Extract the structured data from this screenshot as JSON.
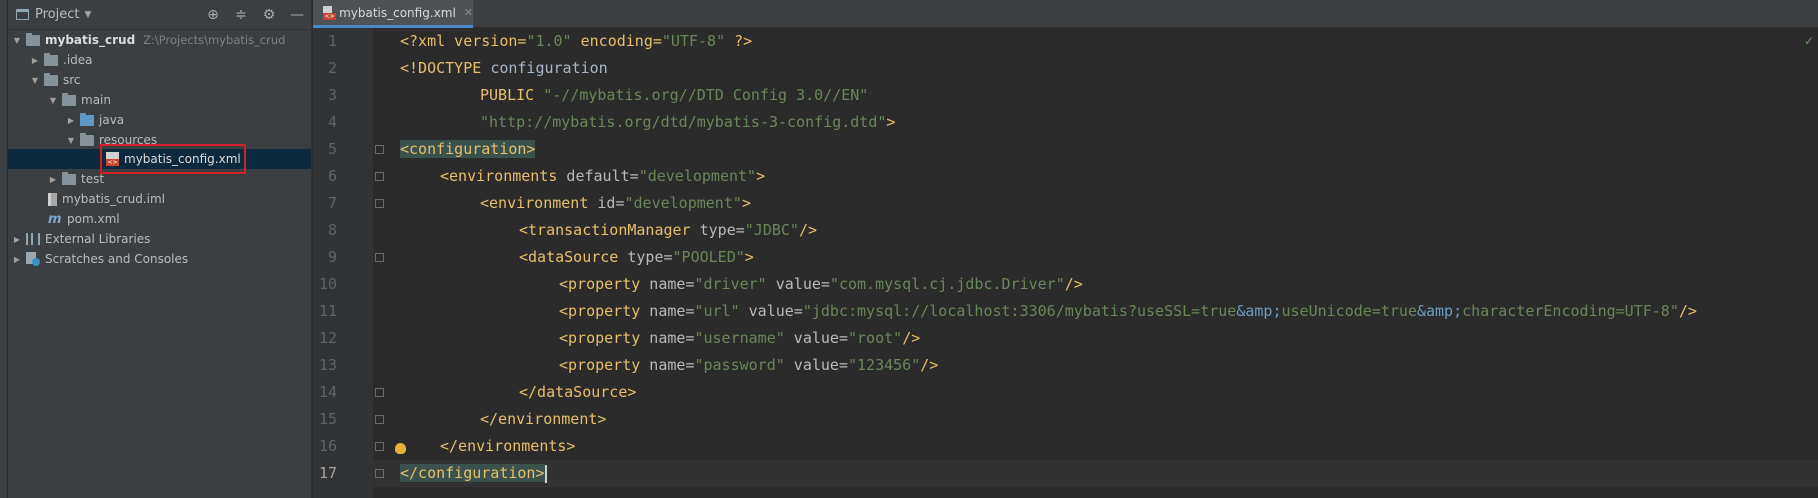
{
  "project_panel": {
    "title": "Project",
    "tree": [
      {
        "label": "mybatis_crud",
        "path": "Z:\\Projects\\mybatis_crud"
      },
      {
        "label": ".idea"
      },
      {
        "label": "src"
      },
      {
        "label": "main"
      },
      {
        "label": "java"
      },
      {
        "label": "resources"
      },
      {
        "label": "mybatis_config.xml"
      },
      {
        "label": "test"
      },
      {
        "label": "mybatis_crud.iml"
      },
      {
        "label": "pom.xml"
      },
      {
        "label": "External Libraries"
      },
      {
        "label": "Scratches and Consoles"
      }
    ]
  },
  "editor": {
    "tab_label": "mybatis_config.xml",
    "current_line": 17,
    "line_numbers": [
      "1",
      "2",
      "3",
      "4",
      "5",
      "6",
      "7",
      "8",
      "9",
      "10",
      "11",
      "12",
      "13",
      "14",
      "15",
      "16",
      "17"
    ],
    "code": {
      "l1_decl": "<?xml version=",
      "l1_v": "\"1.0\"",
      "l1_enc": " encoding=",
      "l1_ev": "\"UTF-8\"",
      "l1_end": " ?>",
      "l2_doctype": "<!DOCTYPE ",
      "l2_name": "configuration",
      "l3_kw": "PUBLIC ",
      "l3_str": "\"-//mybatis.org//DTD Config 3.0//EN\"",
      "l4_str": "\"http://mybatis.org/dtd/mybatis-3-config.dtd\"",
      "l4_end": ">",
      "l5_tag": "<configuration>",
      "l6_open": "<environments",
      "l6_attr": " default=",
      "l6_val": "\"development\"",
      "l6_close": ">",
      "l7_open": "<environment",
      "l7_attr": " id=",
      "l7_val": "\"development\"",
      "l7_close": ">",
      "l8_open": "<transactionManager",
      "l8_attr": " type=",
      "l8_val": "\"JDBC\"",
      "l8_close": "/>",
      "l9_open": "<dataSource",
      "l9_attr": " type=",
      "l9_val": "\"POOLED\"",
      "l9_close": ">",
      "prop_open": "<property",
      "name_attr": " name=",
      "value_attr": " value=",
      "self_close": "/>",
      "l10_name": "\"driver\"",
      "l10_value": "\"com.mysql.cj.jdbc.Driver\"",
      "l11_name": "\"url\"",
      "l11_v1": "\"jdbc:mysql://localhost:3306/mybatis?useSSL=true",
      "amp": "&amp;",
      "l11_v2": "useUnicode=true",
      "l11_v3": "characterEncoding=UTF-8\"",
      "l12_name": "\"username\"",
      "l12_value": "\"root\"",
      "l13_name": "\"password\"",
      "l13_value": "\"123456\"",
      "l14_tag": "</dataSource>",
      "l15_tag": "</environment>",
      "l16_tag": "</environments>",
      "l17_tag": "</configuration>"
    }
  },
  "icons": {
    "project_panel_icon": "window-icon",
    "locate_icon": "crosshair-icon",
    "collapse_icon": "collapse-all-icon",
    "settings_icon": "gear-icon",
    "hide_icon": "minus-icon",
    "file_type_icon": "xml-file-icon",
    "intention_icon": "lightbulb-icon"
  },
  "colors": {
    "selection": "#0d293e",
    "highlight_box": "#d21f2a",
    "tag": "#e8bf6a",
    "string": "#6a8759"
  }
}
